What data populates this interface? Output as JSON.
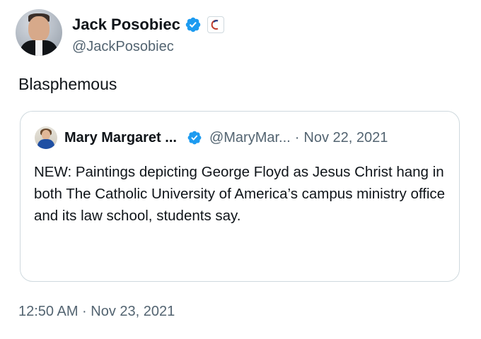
{
  "author": {
    "name": "Jack Posobiec",
    "handle": "@JackPosobiec",
    "verified_icon": "verified-badge-icon",
    "affiliation_icon": "affiliate-badge-icon",
    "accent_color": "#1d9bf0"
  },
  "tweet": {
    "text": "Blasphemous",
    "timestamp": "12:50 AM · Nov 23, 2021"
  },
  "quoted_tweet": {
    "author_name": "Mary Margaret ...",
    "author_handle": "@MaryMar...",
    "separator": "·",
    "date": "Nov 22, 2021",
    "text": "NEW: Paintings depicting George Floyd as Jesus Christ hang in both The Catholic University of America’s campus ministry office and its law school, students say.",
    "verified_icon": "verified-badge-icon"
  },
  "colors": {
    "text_primary": "#0f1419",
    "text_secondary": "#536471",
    "border": "#cfd9de",
    "verified_blue": "#1d9bf0"
  }
}
